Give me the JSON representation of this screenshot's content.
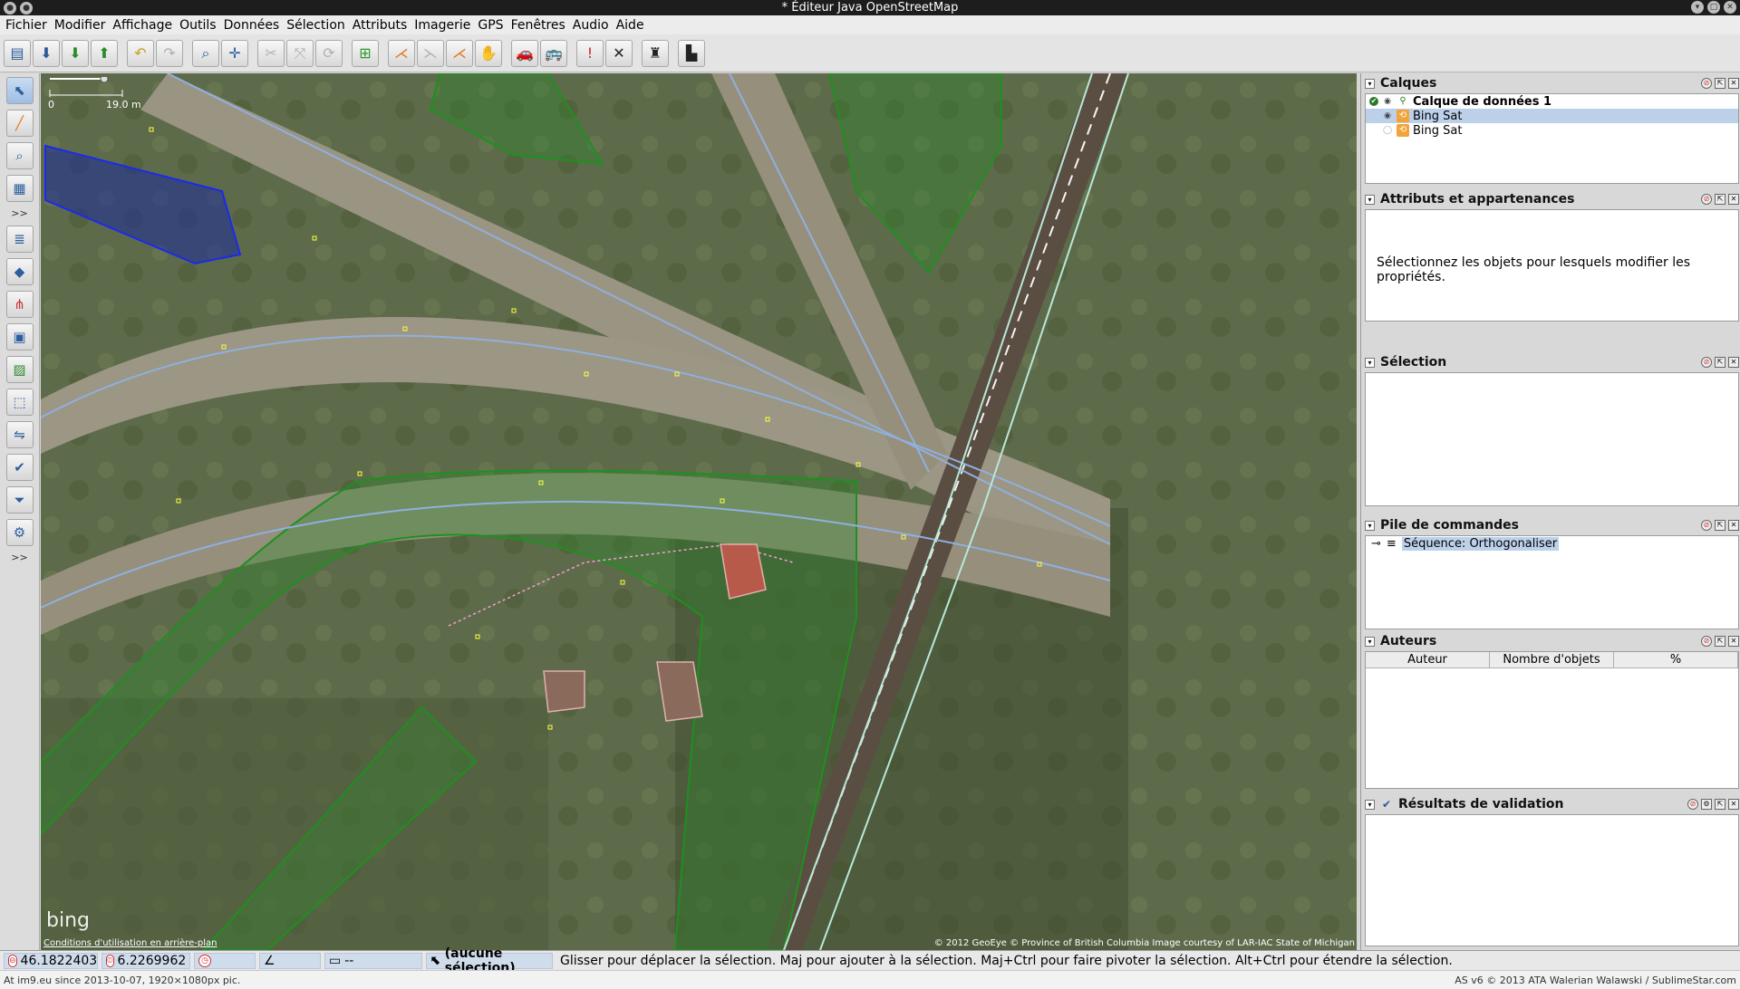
{
  "window": {
    "title": "* Éditeur Java OpenStreetMap"
  },
  "menu": [
    "Fichier",
    "Modifier",
    "Affichage",
    "Outils",
    "Données",
    "Sélection",
    "Attributs",
    "Imagerie",
    "GPS",
    "Fenêtres",
    "Audio",
    "Aide"
  ],
  "toolbar": {
    "icons": [
      "open-file-icon",
      "save-icon",
      "download-icon",
      "upload-icon",
      "undo-icon",
      "redo-icon",
      "zoom-preferences-icon",
      "crosshair-icon",
      "split-way-icon",
      "combine-way-icon",
      "reverse-way-icon",
      "orthogonalize-icon",
      "parallel-icon",
      "align-line-icon",
      "align-circle-icon",
      "hand-icon",
      "car-icon",
      "bus-icon",
      "validation-icon",
      "delete-icon",
      "castle-icon",
      "factory-icon"
    ]
  },
  "left_tools": [
    "select-tool-icon",
    "draw-tool-icon",
    "zoom-tool-icon",
    "building-tool-icon",
    "layer-stack-icon",
    "tag-icon",
    "relation-icon",
    "selection-list-icon",
    "image-icon",
    "filter-icon",
    "two-way-icon",
    "checkmark-icon",
    "funnel-icon",
    "preferences-icon"
  ],
  "map": {
    "scale_start": "0",
    "scale_label": "19.0 m",
    "bing_logo": "bing",
    "terms": "Conditions d'utilisation en arrière-plan",
    "attribution": "© 2012 GeoEye © Province of British Columbia Image courtesy of LAR-IAC State of Michigan"
  },
  "panels": {
    "layers": {
      "title": "Calques",
      "items": [
        {
          "label": "Calque de données 1",
          "selected": false
        },
        {
          "label": "Bing Sat",
          "selected": true
        },
        {
          "label": "Bing Sat",
          "selected": false
        }
      ]
    },
    "properties": {
      "title": "Attributs et appartenances",
      "message": "Sélectionnez les objets pour lesquels modifier les propriétés."
    },
    "selection": {
      "title": "Sélection"
    },
    "command_stack": {
      "title": "Pile de commandes",
      "entry": "Séquence: Orthogonaliser"
    },
    "authors": {
      "title": "Auteurs",
      "columns": [
        "Auteur",
        "Nombre d'objets",
        "%"
      ]
    },
    "validation": {
      "title": "Résultats de validation"
    }
  },
  "status": {
    "lat": "46.1822403",
    "lon": "6.2269962",
    "heading": "",
    "angle": "",
    "distance": "--",
    "selection": "(aucune sélection)",
    "hint": "Glisser pour déplacer la sélection. Maj pour ajouter à la sélection. Maj+Ctrl pour faire pivoter la sélection. Alt+Ctrl pour étendre la sélection."
  },
  "footer": {
    "left": "At im9.eu since 2013-10-07, 1920×1080px pic.",
    "right": "AS v6 © 2013 ATA Walerian Walawski / SublimeStar.com"
  },
  "colors": {
    "osm_way": "#8fb0e0",
    "area_green": "#1f8f1f",
    "area_blue": "#1a2a9a",
    "selection_blue": "#bcd0ea"
  }
}
